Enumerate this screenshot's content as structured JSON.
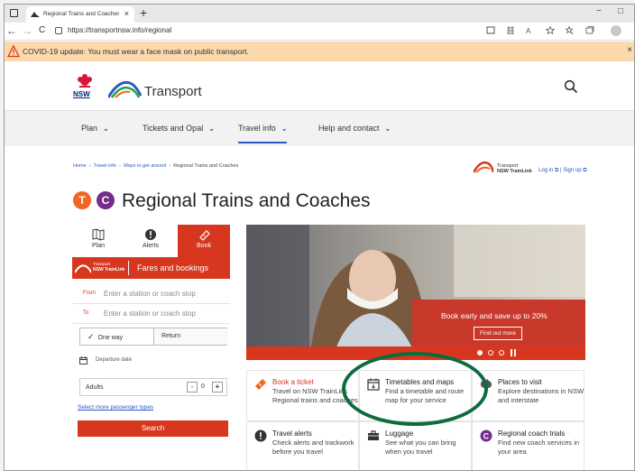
{
  "browser": {
    "tab_title": "Regional Trains and Coaches | tra",
    "tab_close": "×",
    "new_tab": "+",
    "url": "https://transportnsw.info/regional",
    "back": "←",
    "forward": "→",
    "refresh": "C",
    "minimize": "−",
    "maximize": "□"
  },
  "banner": {
    "text": "COVID-19 update: You must wear a face mask on public transport.",
    "close": "×"
  },
  "header": {
    "nsw_label": "NSW",
    "brand": "Transport"
  },
  "nav": {
    "items": [
      {
        "label": "Plan",
        "chevron": "⌄"
      },
      {
        "label": "Tickets and Opal",
        "chevron": "⌄"
      },
      {
        "label": "Travel info",
        "chevron": "⌄"
      },
      {
        "label": "Help and contact",
        "chevron": "⌄"
      }
    ]
  },
  "breadcrumb": {
    "items": [
      "Home",
      "Travel info",
      "Ways to get around"
    ],
    "current": "Regional Trains and Coaches",
    "separator": "›"
  },
  "trainlink": {
    "line1": "Transport",
    "line2": "NSW TrainLink",
    "login": "Log in ⧉ | Sign up ⧉"
  },
  "title": {
    "badge_t": "T",
    "badge_c": "C",
    "text": "Regional Trains and Coaches"
  },
  "panel": {
    "tabs": [
      {
        "label": "Plan"
      },
      {
        "label": "Alerts"
      },
      {
        "label": "Book"
      }
    ],
    "fares_logo_line1": "Transport",
    "fares_logo_line2": "NSW TrainLink",
    "fares_title": "Fares and bookings",
    "from_label": "From",
    "from_placeholder": "Enter a station or coach stop",
    "to_label": "To",
    "to_placeholder": "Enter a station or coach stop",
    "trip_one_way": "One way",
    "trip_return": "Return",
    "check": "✓",
    "date_placeholder": "Departure date",
    "adults_label": "Adults",
    "adults_minus": "-",
    "adults_value": "0",
    "adults_plus": "+",
    "passenger_link": "Select more passenger types",
    "search": "Search"
  },
  "hero": {
    "headline": "Book early and save up to 20%",
    "button": "Find out more"
  },
  "cards": [
    {
      "title": "Book a ticket",
      "desc": "Travel on NSW TrainLink Regional trains and coaches",
      "title_color": "#d7371f"
    },
    {
      "title": "Timetables and maps",
      "desc": "Find a timetable and route map for your service",
      "title_color": "#333333"
    },
    {
      "title": "Places to visit",
      "desc": "Explore destinations in NSW and interstate",
      "title_color": "#333333"
    },
    {
      "title": "Travel alerts",
      "desc": "Check alerts and trackwork before you travel",
      "title_color": "#333333"
    },
    {
      "title": "Luggage",
      "desc": "See what you can bring when you travel",
      "title_color": "#333333"
    },
    {
      "title": "Regional coach trials",
      "desc": "Find new coach services in your area",
      "title_color": "#333333"
    }
  ],
  "colors": {
    "accent_red": "#d7371f",
    "link_blue": "#2b59c3",
    "banner_bg": "#fbd9ac",
    "trains_orange": "#f26522",
    "coach_purple": "#742d8a",
    "highlight_green": "#0d6b3e"
  }
}
